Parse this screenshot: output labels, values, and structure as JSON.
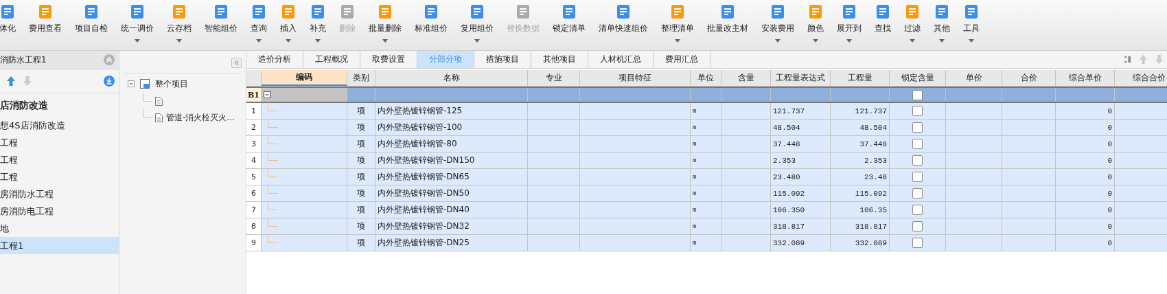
{
  "toolbar": [
    {
      "label": "体化",
      "dropdown": false,
      "disabled": false
    },
    {
      "label": "费用查看",
      "dropdown": false,
      "disabled": false
    },
    {
      "label": "项目自检",
      "dropdown": false,
      "disabled": false
    },
    {
      "label": "统一调价",
      "dropdown": true,
      "disabled": false
    },
    {
      "label": "云存档",
      "dropdown": true,
      "disabled": false
    },
    {
      "label": "智能组价",
      "dropdown": false,
      "disabled": false
    },
    {
      "label": "查询",
      "dropdown": true,
      "disabled": false
    },
    {
      "label": "插入",
      "dropdown": true,
      "disabled": false
    },
    {
      "label": "补充",
      "dropdown": true,
      "disabled": false
    },
    {
      "label": "删除",
      "dropdown": false,
      "disabled": true
    },
    {
      "label": "批量删除",
      "dropdown": true,
      "disabled": false
    },
    {
      "label": "标准组价",
      "dropdown": false,
      "disabled": false
    },
    {
      "label": "复用组价",
      "dropdown": true,
      "disabled": false
    },
    {
      "label": "替换数据",
      "dropdown": false,
      "disabled": true
    },
    {
      "label": "锁定清单",
      "dropdown": false,
      "disabled": false
    },
    {
      "label": "清单快速组价",
      "dropdown": false,
      "disabled": false
    },
    {
      "label": "整理清单",
      "dropdown": true,
      "disabled": false
    },
    {
      "label": "批量改主材",
      "dropdown": false,
      "disabled": false
    },
    {
      "label": "安装费用",
      "dropdown": true,
      "disabled": false
    },
    {
      "label": "颜色",
      "dropdown": true,
      "disabled": false
    },
    {
      "label": "展开到",
      "dropdown": true,
      "disabled": false
    },
    {
      "label": "查找",
      "dropdown": false,
      "disabled": false
    },
    {
      "label": "过滤",
      "dropdown": true,
      "disabled": false
    },
    {
      "label": "其他",
      "dropdown": true,
      "disabled": false
    },
    {
      "label": "工具",
      "dropdown": true,
      "disabled": false
    }
  ],
  "project_panel": {
    "title": "消防水工程1",
    "items": [
      {
        "label": "店消防改造",
        "bold": true,
        "selected": false
      },
      {
        "label": "想4S店消防改造",
        "bold": false,
        "selected": false
      },
      {
        "label": "工程",
        "bold": false,
        "selected": false
      },
      {
        "label": "工程",
        "bold": false,
        "selected": false
      },
      {
        "label": "工程",
        "bold": false,
        "selected": false
      },
      {
        "label": "房消防水工程",
        "bold": false,
        "selected": false
      },
      {
        "label": "房消防电工程",
        "bold": false,
        "selected": false
      },
      {
        "label": "地",
        "bold": false,
        "selected": false
      },
      {
        "label": "工程1",
        "bold": false,
        "selected": true
      }
    ]
  },
  "tree": {
    "label": "整个项目",
    "expanded": true,
    "children": [
      {
        "kind": "file"
      },
      {
        "kind": "file",
        "label": "管道-消火栓灭火..."
      }
    ]
  },
  "tabs": [
    {
      "label": "造价分析",
      "selected": false
    },
    {
      "label": "工程概况",
      "selected": false
    },
    {
      "label": "取费设置",
      "selected": false
    },
    {
      "label": "分部分项",
      "selected": true
    },
    {
      "label": "措施项目",
      "selected": false
    },
    {
      "label": "其他项目",
      "selected": false
    },
    {
      "label": "人材机汇总",
      "selected": false
    },
    {
      "label": "费用汇总",
      "selected": false
    }
  ],
  "table": {
    "columns": [
      "编码",
      "类别",
      "名称",
      "专业",
      "项目特征",
      "单位",
      "含量",
      "工程量表达式",
      "工程量",
      "锁定含量",
      "单价",
      "合价",
      "综合单价",
      "综合合价"
    ],
    "section_row": {
      "label": "B1",
      "expanded": true,
      "locked": false
    },
    "rows": [
      {
        "num": "1",
        "type": "项",
        "name": "内外壁热镀锌钢管-125",
        "unit": "m",
        "expression": "121.737",
        "quantity": "121.737",
        "locked": false,
        "unit_price": "0"
      },
      {
        "num": "2",
        "type": "项",
        "name": "内外壁热镀锌钢管-100",
        "unit": "m",
        "expression": "48.504",
        "quantity": "48.504",
        "locked": false,
        "unit_price": "0"
      },
      {
        "num": "3",
        "type": "项",
        "name": "内外壁热镀锌钢管-80",
        "unit": "m",
        "expression": "37.448",
        "quantity": "37.448",
        "locked": false,
        "unit_price": "0"
      },
      {
        "num": "4",
        "type": "项",
        "name": "内外壁热镀锌钢管-DN150",
        "unit": "m",
        "expression": "2.353",
        "quantity": "2.353",
        "locked": false,
        "unit_price": "0"
      },
      {
        "num": "5",
        "type": "项",
        "name": "内外壁热镀锌钢管-DN65",
        "unit": "m",
        "expression": "23.480",
        "quantity": "23.48",
        "locked": false,
        "unit_price": "0"
      },
      {
        "num": "6",
        "type": "项",
        "name": "内外壁热镀锌钢管-DN50",
        "unit": "m",
        "expression": "115.092",
        "quantity": "115.092",
        "locked": false,
        "unit_price": "0"
      },
      {
        "num": "7",
        "type": "项",
        "name": "内外壁热镀锌钢管-DN40",
        "unit": "m",
        "expression": "106.350",
        "quantity": "106.35",
        "locked": false,
        "unit_price": "0"
      },
      {
        "num": "8",
        "type": "项",
        "name": "内外壁热镀锌钢管-DN32",
        "unit": "m",
        "expression": "318.817",
        "quantity": "318.817",
        "locked": false,
        "unit_price": "0"
      },
      {
        "num": "9",
        "type": "项",
        "name": "内外壁热镀锌钢管-DN25",
        "unit": "m",
        "expression": "332.089",
        "quantity": "332.089",
        "locked": false,
        "unit_price": "0"
      }
    ]
  }
}
